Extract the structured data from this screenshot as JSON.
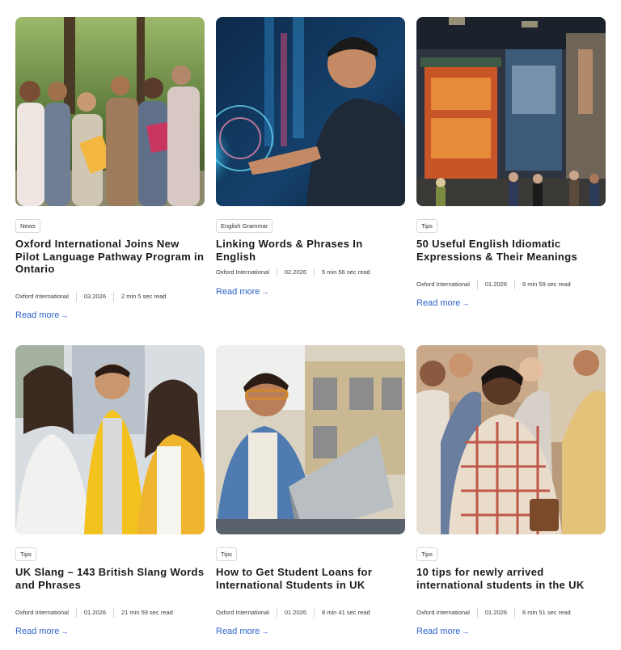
{
  "articles": [
    {
      "category": "News",
      "title": "Oxford International Joins New Pilot Language Pathway Program in Ontario",
      "author": "Oxford International",
      "date": "03.2026",
      "read_time": "2 min 5 sec read",
      "read_more": "Read more",
      "image_icon": "group-of-students-photo"
    },
    {
      "category": "English Grammar",
      "title": "Linking Words & Phrases In English",
      "author": "Oxford International",
      "date": "02.2026",
      "read_time": "5 min 56 sec read",
      "read_more": "Read more",
      "image_icon": "student-touching-digital-screen-photo"
    },
    {
      "category": "Tips",
      "title": "50 Useful English Idiomatic Expressions & Their Meanings",
      "author": "Oxford International",
      "date": "01.2026",
      "read_time": "9 min 59 sec read",
      "read_more": "Read more",
      "image_icon": "diagon-alley-shopfront-photo"
    },
    {
      "category": "Tips",
      "title": "UK Slang – 143 British Slang Words and Phrases",
      "author": "Oxford International",
      "date": "01.2026",
      "read_time": "21 min 59 sec read",
      "read_more": "Read more",
      "image_icon": "friends-laughing-photo"
    },
    {
      "category": "Tips",
      "title": "How to Get Student Loans for International Students in UK",
      "author": "Oxford International",
      "date": "01.2026",
      "read_time": "8 min 41 sec read",
      "read_more": "Read more",
      "image_icon": "student-with-laptop-photo"
    },
    {
      "category": "Tips",
      "title": "10 tips for newly arrived international students in the UK",
      "author": "Oxford International",
      "date": "01.2026",
      "read_time": "6 min 51 sec read",
      "read_more": "Read more",
      "image_icon": "students-group-campus-photo"
    }
  ],
  "colors": {
    "link": "#2b62c9",
    "title": "#1a1a1a",
    "meta": "#3a3a3a",
    "badge_border": "#d8d8d8"
  },
  "icons": {
    "read_more_arrow": "arrow-right-icon"
  }
}
